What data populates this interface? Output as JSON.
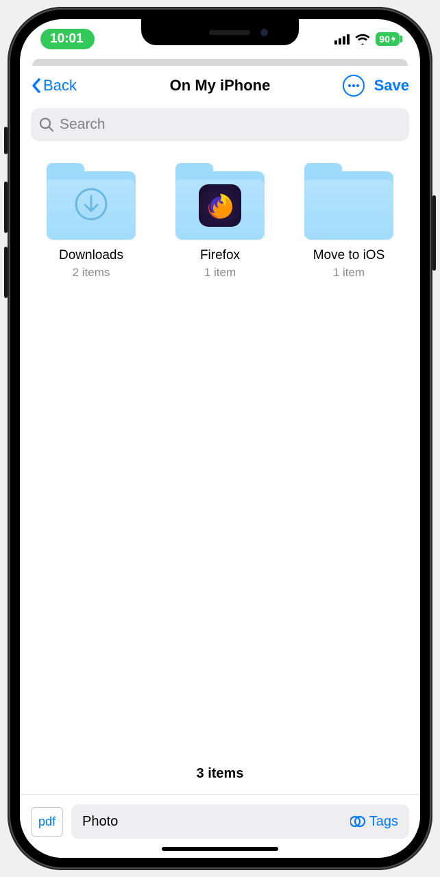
{
  "status": {
    "time": "10:01",
    "battery": "90"
  },
  "nav": {
    "back": "Back",
    "title": "On My iPhone",
    "save": "Save"
  },
  "search": {
    "placeholder": "Search"
  },
  "folders": [
    {
      "name": "Downloads",
      "subtitle": "2 items",
      "icon": "download"
    },
    {
      "name": "Firefox",
      "subtitle": "1 item",
      "icon": "firefox"
    },
    {
      "name": "Move to iOS",
      "subtitle": "1 item",
      "icon": "none"
    }
  ],
  "footer": {
    "count": "3 items"
  },
  "toolbar": {
    "file_type": "pdf",
    "file_name": "Photo",
    "tags_label": "Tags"
  }
}
